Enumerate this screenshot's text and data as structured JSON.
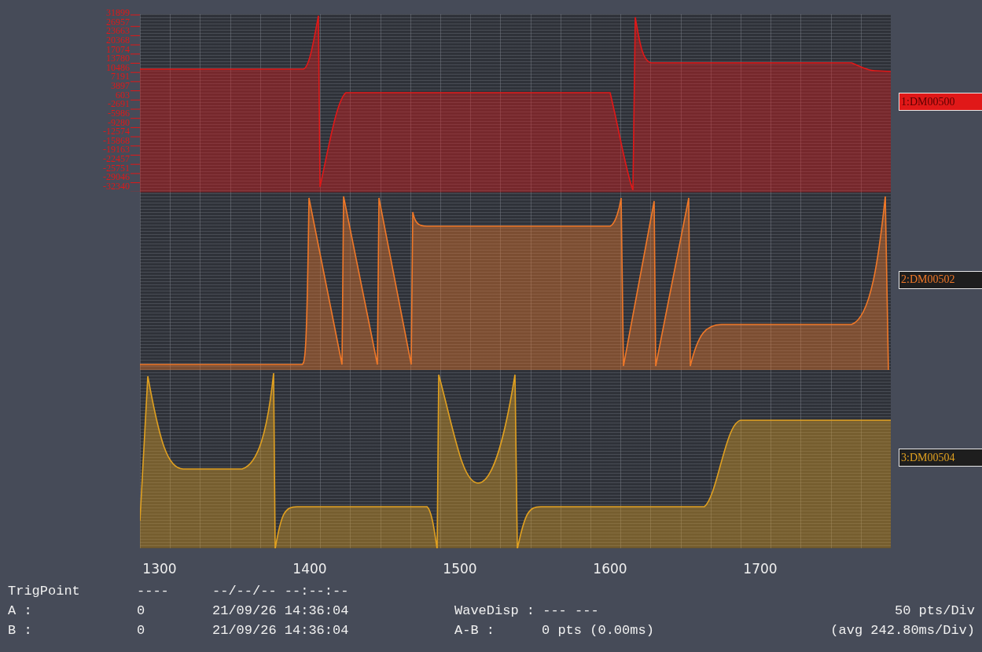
{
  "y_axis": {
    "labels": [
      "31899",
      "26957",
      "23663",
      "20368",
      "17074",
      "13780",
      "10486",
      "7191",
      "3897",
      "603",
      "-2691",
      "-5986",
      "-9280",
      "-12574",
      "-15868",
      "-19163",
      "-22457",
      "-25751",
      "-29046",
      "-32340"
    ]
  },
  "channels": [
    {
      "label": "1:DM00500",
      "color": "#e01818",
      "selected": true
    },
    {
      "label": "2:DM00502",
      "color": "#f07828",
      "selected": false
    },
    {
      "label": "3:DM00504",
      "color": "#e0a020",
      "selected": false
    }
  ],
  "x_axis": {
    "labels": [
      "1300",
      "1400",
      "1500",
      "1600",
      "1700"
    ]
  },
  "info": {
    "rows": [
      {
        "name": "TrigPoint",
        "value": "----",
        "time": "--/--/-- --:--:--"
      },
      {
        "name": "A :",
        "value": "0",
        "time": "21/09/26 14:36:04"
      },
      {
        "name": "B :",
        "value": "0",
        "time": "21/09/26 14:36:04"
      }
    ],
    "wave_disp": "WaveDisp : --- ---",
    "ab_label": "A-B :",
    "ab_value": "0 pts (0.00ms)",
    "scale": "50 pts/Div",
    "avg": "(avg 242.80ms/Div)"
  }
}
